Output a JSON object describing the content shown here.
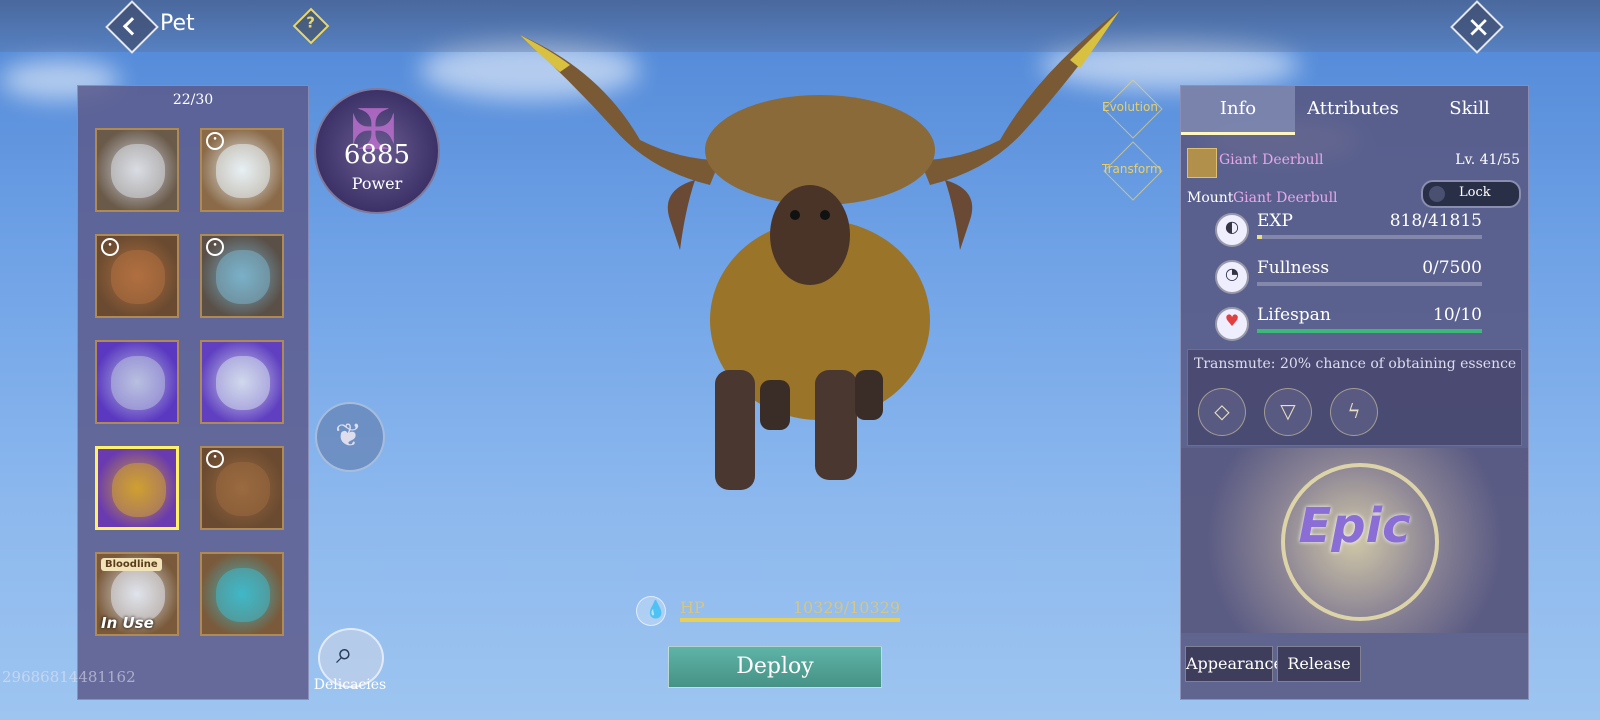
{
  "header": {
    "title": "Pet",
    "help": "?",
    "close": "✕"
  },
  "collection": {
    "count": "22/30",
    "slots": [
      {
        "kind": "character",
        "locked": false,
        "colors": [
          "#6a5a4a",
          "#d8dce4"
        ]
      },
      {
        "kind": "fox",
        "locked": true,
        "colors": [
          "#8a6a48",
          "#e8f0f4"
        ]
      },
      {
        "kind": "lion",
        "locked": true,
        "colors": [
          "#6a4a30",
          "#b07040"
        ]
      },
      {
        "kind": "dragon",
        "locked": true,
        "colors": [
          "#5a5048",
          "#7ab0c8"
        ]
      },
      {
        "kind": "drake",
        "locked": false,
        "colors": [
          "#5a38c0",
          "#b8c0e0"
        ]
      },
      {
        "kind": "serpent",
        "locked": false,
        "colors": [
          "#6040c0",
          "#d0d8ec"
        ]
      },
      {
        "kind": "deerbull",
        "locked": false,
        "selected": true,
        "colors": [
          "#6a3ab0",
          "#d0a030"
        ]
      },
      {
        "kind": "boar",
        "locked": true,
        "colors": [
          "#6a4a30",
          "#9a6a40"
        ]
      },
      {
        "kind": "bloodline",
        "locked": false,
        "badge": "Bloodline",
        "status": "In Use",
        "colors": [
          "#7a5a3a",
          "#e0e4ec"
        ]
      },
      {
        "kind": "fish",
        "locked": false,
        "colors": [
          "#7a5a3a",
          "#40b8c8"
        ]
      }
    ]
  },
  "power": {
    "value": "6885",
    "label": "Power"
  },
  "delicacies": {
    "label": "Delicacies"
  },
  "uid": "29686814481162",
  "evolution": {
    "evolution_label": "Evolution",
    "transform_label": "Transform"
  },
  "hp": {
    "label": "HP",
    "value": "10329/10329",
    "fraction": 1.0
  },
  "deploy": {
    "label": "Deploy"
  },
  "info": {
    "tabs": [
      {
        "label": "Info",
        "active": true
      },
      {
        "label": "Attributes",
        "active": false
      },
      {
        "label": "Skill",
        "active": false
      }
    ],
    "pet_name": "Giant Deerbull",
    "level": "Lv. 41/55",
    "mount_label": "Mount",
    "mount_name": "Giant Deerbull",
    "lock_label": "Lock",
    "stats": [
      {
        "label": "EXP",
        "value": "818/41815",
        "fraction": 0.02,
        "color": "#e8e080",
        "icon": "swirl-icon",
        "glyph": "◐"
      },
      {
        "label": "Fullness",
        "value": "0/7500",
        "fraction": 0.0,
        "color": "#e8e080",
        "icon": "stomach-icon",
        "glyph": "◔"
      },
      {
        "label": "Lifespan",
        "value": "10/10",
        "fraction": 1.0,
        "color": "#3cb878",
        "icon": "heart-icon",
        "glyph": "♥"
      }
    ],
    "transmute": "Transmute: 20% chance of obtaining essence",
    "essences": [
      "◇",
      "▽",
      "ϟ"
    ],
    "rarity": "Epic",
    "appearance": "Appearance",
    "release": "Release"
  },
  "colors": {
    "accent": "#e8d056",
    "panel": "#5c5a8c",
    "deploy": "#5fb3a7",
    "pet_name": "#e6a8e8"
  }
}
